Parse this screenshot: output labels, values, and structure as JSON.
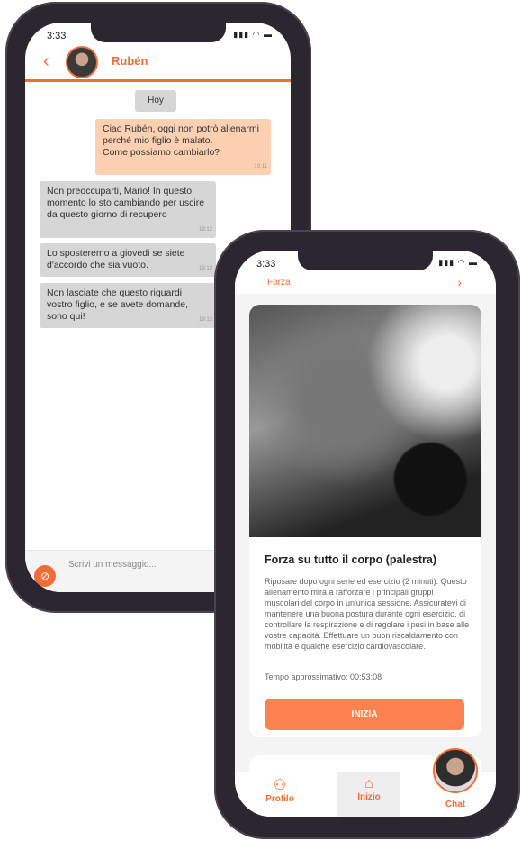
{
  "chat_phone": {
    "status_time": "3:33",
    "contact_name": "Rubén",
    "date_chip": "Hoy",
    "messages": [
      {
        "from": "me",
        "text": "Ciao Rubén, oggi non potrò allenarmi perché mio figlio è malato.\nCome possiamo cambiarlo?",
        "time": "19:11"
      },
      {
        "from": "coach",
        "text": "Non preoccuparti, Mario! In questo momento lo sto cambiando per uscire da questo giorno di recupero",
        "time": "19:12"
      },
      {
        "from": "coach",
        "text": "Lo sposteremo a giovedi se siete d'accordo che sia vuoto.",
        "time": "19:12"
      },
      {
        "from": "coach",
        "text": "Non lasciate che questo riguardi vostro figlio, e se avete domande, sono qui!",
        "time": "19:12"
      }
    ],
    "input_placeholder": "Scrivi un messaggio..."
  },
  "workout_phone": {
    "status_time": "3:33",
    "category": "Forza",
    "title": "Forza su tutto il corpo (palestra)",
    "description": "Riposare dopo ogni serie ed esercizio (2 minuti). Questo allenamento mira a rafforzare i principali gruppi muscolari del corpo in un'unica sessione. Assicuratevi di mantenere una buona postura durante ogni esercizio, di controllare la respirazione e di regolare i pesi in base alle vostre capacità. Effettuare un buon riscaldamento con mobilità e qualche esercizio cardiovascolare.",
    "time_label": "Tempo approssimativo: 00:53:08",
    "start_button": "INIZIA",
    "nav": [
      {
        "label": "Profilo",
        "icon": "user-icon"
      },
      {
        "label": "Inizio",
        "icon": "home-icon",
        "active": true
      },
      {
        "label": "Chat",
        "icon": "avatar"
      }
    ]
  },
  "colors": {
    "accent": "#f36c35",
    "outgoing_bubble": "#fdd0b1",
    "incoming_bubble": "#d6d6d6",
    "frame": "#2b2630"
  }
}
